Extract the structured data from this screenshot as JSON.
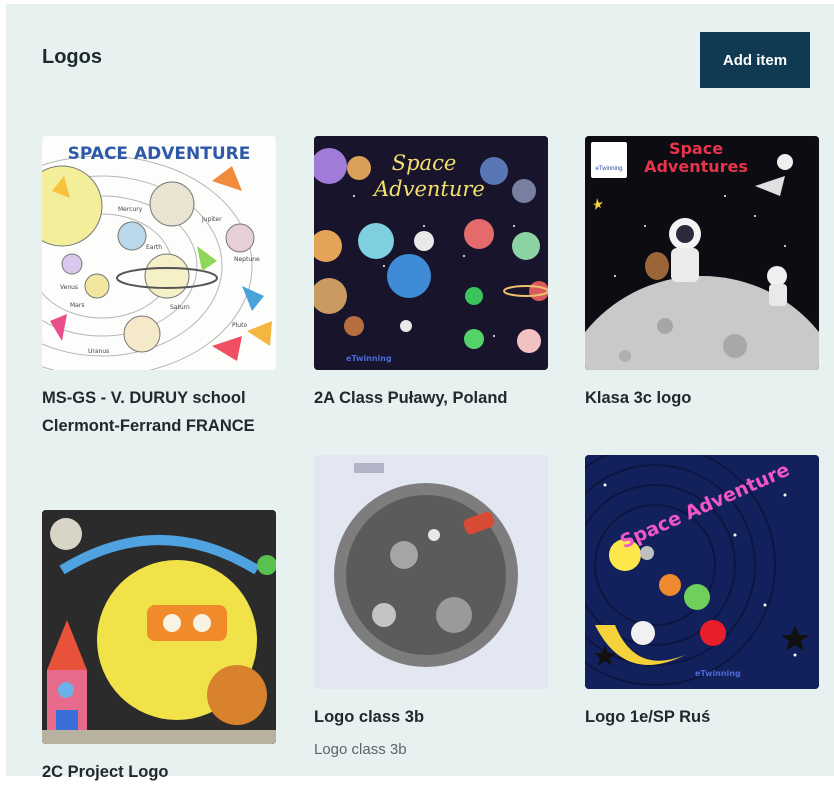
{
  "header": {
    "title": "Logos",
    "add_label": "Add item"
  },
  "items": [
    {
      "caption": "MS-GS - V. DURUY school Clermont-Ferrand FRANCE",
      "subtitle": "",
      "image_text": "SPACE ADVENTURE",
      "image_labels": [
        "Mercury",
        "Jupiter",
        "Earth",
        "Neptune",
        "Venus",
        "Saturn",
        "Mars",
        "Pluto",
        "Uranus"
      ]
    },
    {
      "caption": "2A Class Puławy, Poland",
      "subtitle": "",
      "image_text": "Space Adventure",
      "image_footer": "eTwinning"
    },
    {
      "caption": "Klasa 3c logo",
      "subtitle": "",
      "image_text": "Space Adventures",
      "image_badge": "eTwinning"
    },
    {
      "caption": "2C Project Logo",
      "subtitle": "",
      "image_text": ""
    },
    {
      "caption": "Logo class 3b",
      "subtitle": "Logo class 3b",
      "image_text": ""
    },
    {
      "caption": "Logo 1e/SP Ruś",
      "subtitle": "",
      "image_text": "Space Adventure",
      "image_footer": "eTwinning"
    }
  ],
  "colors": {
    "panel": "#e7f1ef",
    "button": "#0f3a52"
  }
}
